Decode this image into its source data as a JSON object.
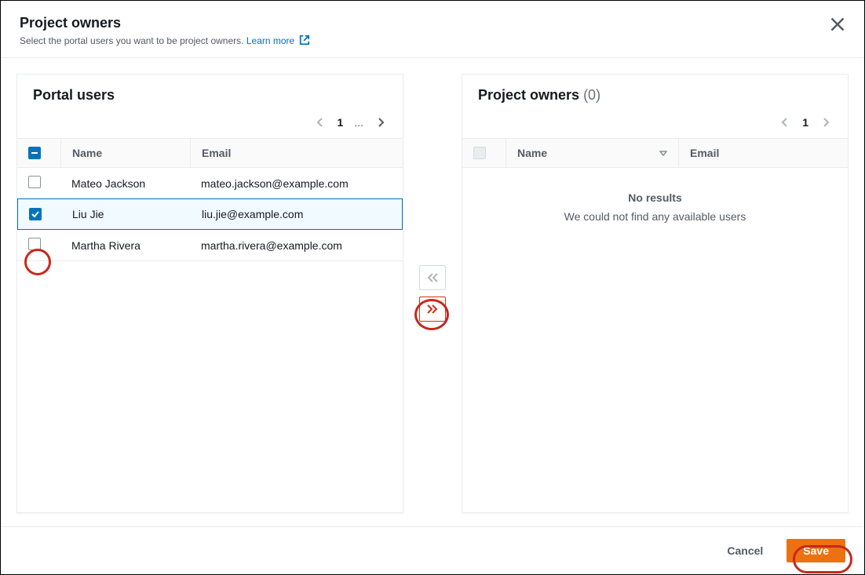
{
  "header": {
    "title": "Project owners",
    "subtitle": "Select the portal users you want to be project owners.",
    "learn_more": "Learn more"
  },
  "left_panel": {
    "title": "Portal users",
    "page": "1",
    "ellipsis": "...",
    "columns": {
      "name": "Name",
      "email": "Email"
    },
    "users": [
      {
        "name": "Mateo Jackson",
        "email": "mateo.jackson@example.com",
        "checked": false
      },
      {
        "name": "Liu Jie",
        "email": "liu.jie@example.com",
        "checked": true
      },
      {
        "name": "Martha Rivera",
        "email": "martha.rivera@example.com",
        "checked": false
      }
    ]
  },
  "right_panel": {
    "title": "Project owners",
    "count": "(0)",
    "page": "1",
    "columns": {
      "name": "Name",
      "email": "Email"
    },
    "empty_title": "No results",
    "empty_sub": "We could not find any available users"
  },
  "footer": {
    "cancel": "Cancel",
    "save": "Save"
  }
}
